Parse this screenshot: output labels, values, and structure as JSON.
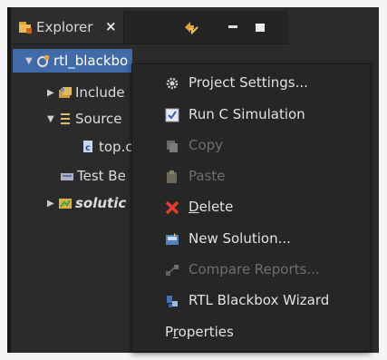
{
  "explorer": {
    "tab_label": "Explorer",
    "tab_close": "×",
    "toolbar": {
      "sync_icon": "link-with-editor-icon",
      "minimize_icon": "minimize-icon",
      "maximize_icon": "maximize-icon"
    }
  },
  "tree": {
    "items": [
      {
        "label": "rtl_blackbo",
        "icon": "project-icon",
        "expanded": true,
        "selected": true
      },
      {
        "label": "Include",
        "icon": "includes-folder-icon",
        "expanded": false
      },
      {
        "label": "Source",
        "icon": "source-folder-icon",
        "expanded": true
      },
      {
        "label": "top.c",
        "icon": "c-file-icon"
      },
      {
        "label": "Test Be",
        "icon": "testbench-folder-icon"
      },
      {
        "label": "solutic",
        "icon": "solution-folder-icon",
        "expanded": false
      }
    ]
  },
  "context_menu": {
    "items": [
      {
        "label": "Project Settings...",
        "icon": "settings-gear-icon",
        "enabled": true
      },
      {
        "label": "Run C Simulation",
        "icon": "checkbox-icon",
        "enabled": true
      },
      {
        "label": "Copy",
        "icon": "copy-icon",
        "enabled": false
      },
      {
        "label": "Paste",
        "icon": "paste-icon",
        "enabled": false
      },
      {
        "label": "Delete",
        "icon": "delete-x-icon",
        "enabled": true,
        "mnemonic": "D"
      },
      {
        "label": "New Solution...",
        "icon": "new-solution-icon",
        "enabled": true
      },
      {
        "label": "Compare Reports...",
        "icon": "compare-icon",
        "enabled": false
      },
      {
        "label": "RTL Blackbox Wizard",
        "icon": "wizard-icon",
        "enabled": true
      },
      {
        "label": "Properties",
        "icon": "",
        "enabled": true,
        "mnemonic": "r"
      }
    ]
  },
  "colors": {
    "background": "#2b2b2b",
    "selection": "#3f6ba7",
    "menu_bg": "#262626",
    "text": "#e2e2e2",
    "disabled_text": "#6f6f6f",
    "delete_red": "#e63a2e"
  }
}
